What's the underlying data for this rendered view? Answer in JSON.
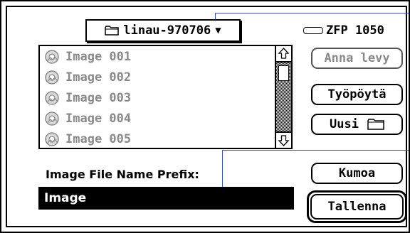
{
  "folder_popup": {
    "label": "linau-970706",
    "arrow": "▼",
    "icon": "folder-icon"
  },
  "volume": {
    "label": "ZFP 1050",
    "icon": "disk-drive-icon"
  },
  "files": [
    {
      "label": "Image 001",
      "icon": "image-file-icon"
    },
    {
      "label": "Image 002",
      "icon": "image-file-icon"
    },
    {
      "label": "Image 003",
      "icon": "image-file-icon"
    },
    {
      "label": "Image 004",
      "icon": "image-file-icon"
    },
    {
      "label": "Image 005",
      "icon": "image-file-icon"
    }
  ],
  "buttons": {
    "eject": "Anna levy",
    "desktop": "Työpöytä",
    "new_folder": "Uusi",
    "cancel": "Kumoa",
    "save": "Tallenna"
  },
  "prefix": {
    "label": "Image File Name Prefix:",
    "value": "Image"
  },
  "colors": {
    "callout": "#3a56a8",
    "disabled_text": "#8a8a8a"
  }
}
